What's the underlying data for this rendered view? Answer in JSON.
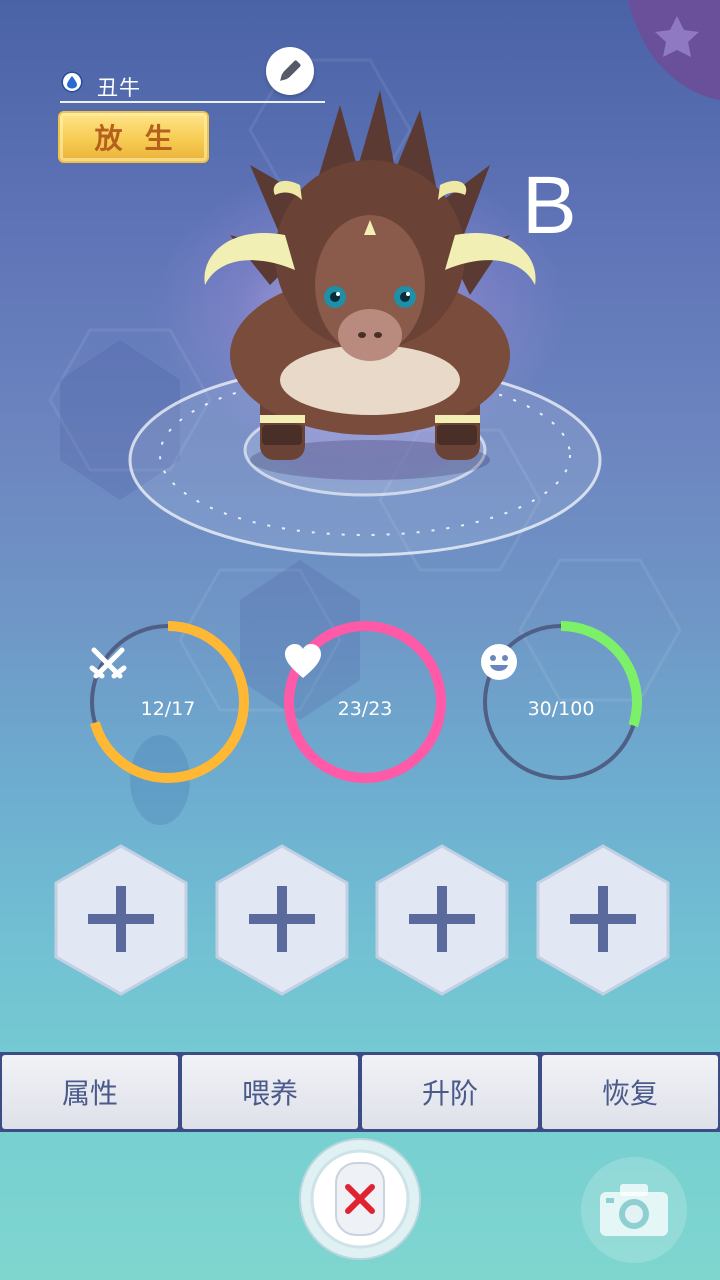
{
  "pet": {
    "name": "丑牛",
    "grade": "B",
    "release_label": "放生"
  },
  "stats": [
    {
      "icon": "crossed-swords-icon",
      "value": "12/17",
      "current": 12,
      "max": 17,
      "color": "#ffb833"
    },
    {
      "icon": "heart-icon",
      "value": "23/23",
      "current": 23,
      "max": 23,
      "color": "#ff5aa8"
    },
    {
      "icon": "smiley-face-icon",
      "value": "30/100",
      "current": 30,
      "max": 100,
      "color": "#7df06a"
    }
  ],
  "tabs": [
    "属性",
    "喂养",
    "升阶",
    "恢复"
  ],
  "colors": {
    "tab_text": "#4a5a8a",
    "tab_bar": "#3c4d86",
    "release_text": "#b5601e",
    "close_x": "#e0232f"
  }
}
